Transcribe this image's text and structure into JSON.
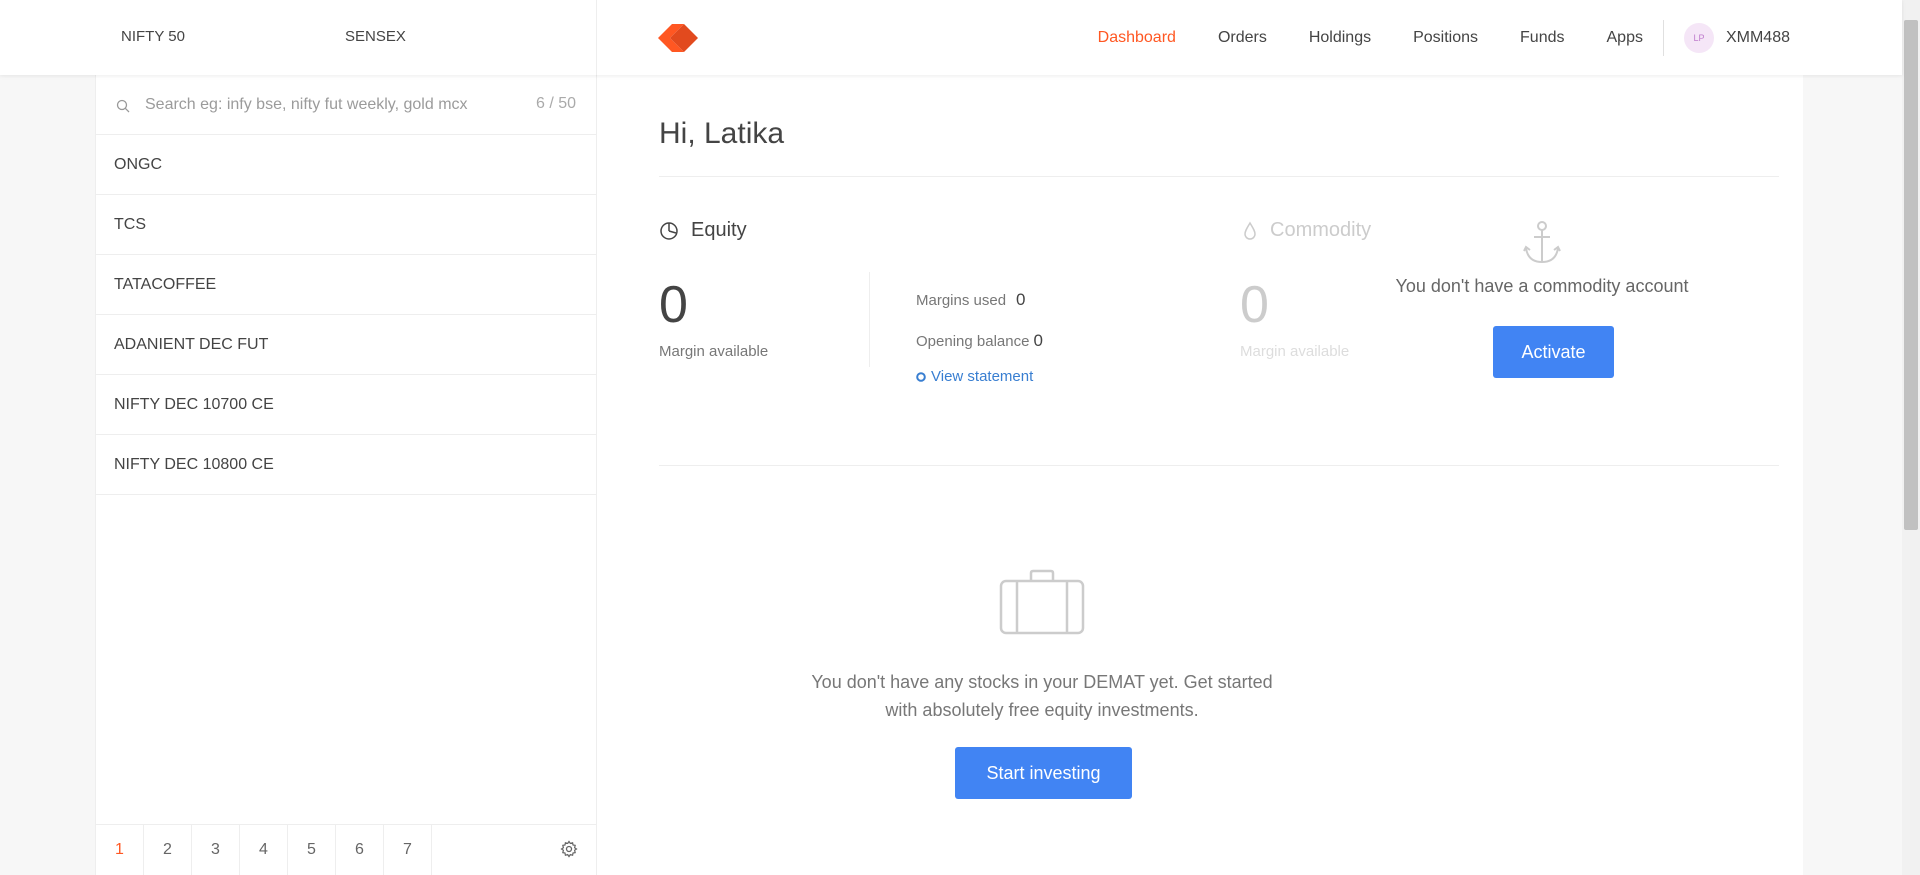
{
  "header": {
    "indices": [
      "NIFTY 50",
      "SENSEX"
    ],
    "nav": [
      "Dashboard",
      "Orders",
      "Holdings",
      "Positions",
      "Funds",
      "Apps"
    ],
    "active_nav": "Dashboard",
    "user": {
      "initials": "LP",
      "id": "XMM488"
    },
    "accent_color": "#ff5722"
  },
  "sidebar": {
    "search": {
      "placeholder": "Search eg: infy bse, nifty fut weekly, gold mcx",
      "value": "",
      "count": "6 / 50"
    },
    "items": [
      "ONGC",
      "TCS",
      "TATACOFFEE",
      "ADANIENT DEC FUT",
      "NIFTY DEC 10700 CE",
      "NIFTY DEC 10800 CE"
    ],
    "pages": [
      "1",
      "2",
      "3",
      "4",
      "5",
      "6",
      "7"
    ],
    "active_page": "1"
  },
  "main": {
    "greeting": "Hi, Latika",
    "equity": {
      "title": "Equity",
      "margin_available": "0",
      "margin_label": "Margin available",
      "margins_used_label": "Margins used",
      "margins_used": "0",
      "opening_balance_label": "Opening balance",
      "opening_balance": "0",
      "view_statement": "View statement"
    },
    "commodity": {
      "title": "Commodity",
      "margin_available": "0",
      "margin_label": "Margin available",
      "message": "You don't have a commodity account",
      "activate": "Activate"
    },
    "holdings_empty": {
      "message": "You don't have any stocks in your DEMAT yet. Get started with absolutely free equity investments.",
      "cta": "Start investing"
    },
    "button_color": "#4184f3"
  }
}
